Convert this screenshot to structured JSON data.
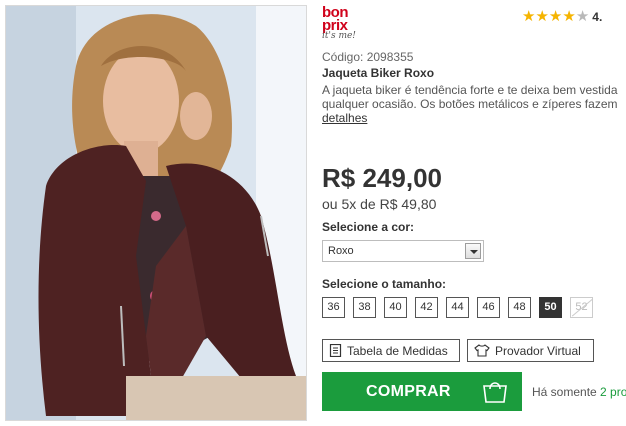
{
  "brand": {
    "logo_top": "bon prix",
    "logo_sub": "it's me!"
  },
  "rating": {
    "stars_filled": 4,
    "stars_total": 5,
    "value": "4."
  },
  "product": {
    "code": "Código: 2098355",
    "name": "Jaqueta Biker Roxo",
    "description_line1": "A jaqueta biker é tendência forte e te deixa bem vestida",
    "description_line2": "qualquer ocasião. Os botões metálicos e zíperes fazem",
    "details_link": "detalhes"
  },
  "price": {
    "main": "R$ 249,00",
    "installments": "ou 5x de R$ 49,80"
  },
  "color": {
    "label": "Selecione a cor:",
    "selected": "Roxo"
  },
  "size": {
    "label": "Selecione o tamanho:",
    "options": [
      "36",
      "38",
      "40",
      "42",
      "44",
      "46",
      "48",
      "50",
      "52"
    ],
    "selected": "50",
    "unavailable": [
      "52"
    ]
  },
  "actions": {
    "size_chart": "Tabela de Medidas",
    "virtual_fitting": "Provador Virtual",
    "buy": "COMPRAR"
  },
  "stock": {
    "prefix": "Há somente",
    "count": "2 pro"
  },
  "colors": {
    "buy_green": "#1b9c3d",
    "brand_red": "#d0021b",
    "star_gold": "#f5b400"
  }
}
